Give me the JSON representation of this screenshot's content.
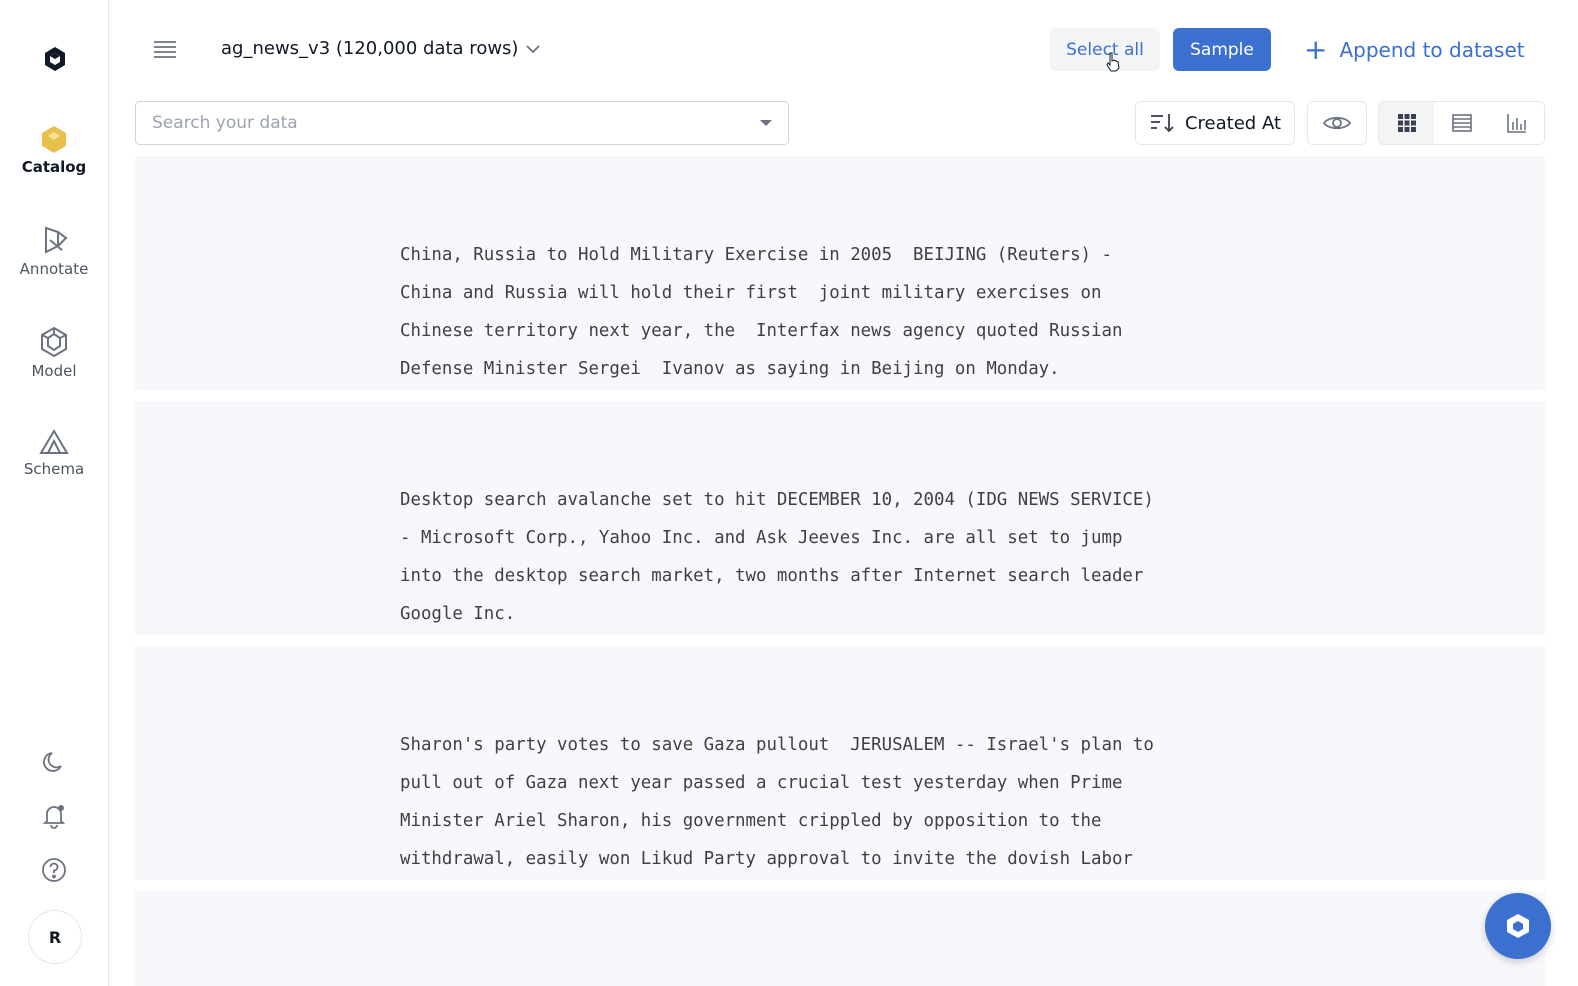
{
  "sidebar": {
    "items": [
      {
        "label": "Catalog",
        "icon": "catalog-icon",
        "active": true
      },
      {
        "label": "Annotate",
        "icon": "annotate-icon",
        "active": false
      },
      {
        "label": "Model",
        "icon": "model-icon",
        "active": false
      },
      {
        "label": "Schema",
        "icon": "schema-icon",
        "active": false
      }
    ],
    "avatar_initial": "R"
  },
  "header": {
    "dataset_title": "ag_news_v3 (120,000 data rows)",
    "select_all_label": "Select all",
    "sample_label": "Sample",
    "append_label": "Append to dataset"
  },
  "toolbar": {
    "search_placeholder": "Search your data",
    "sort_label": "Created At"
  },
  "rows": [
    {
      "text": "China, Russia to Hold Military Exercise in 2005  BEIJING (Reuters) -\nChina and Russia will hold their first  joint military exercises on\nChinese territory next year, the  Interfax news agency quoted Russian\nDefense Minister Sergei  Ivanov as saying in Beijing on Monday."
    },
    {
      "text": "Desktop search avalanche set to hit DECEMBER 10, 2004 (IDG NEWS SERVICE)\n- Microsoft Corp., Yahoo Inc. and Ask Jeeves Inc. are all set to jump\ninto the desktop search market, two months after Internet search leader\nGoogle Inc."
    },
    {
      "text": "Sharon's party votes to save Gaza pullout  JERUSALEM -- Israel's plan to\npull out of Gaza next year passed a crucial test yesterday when Prime\nMinister Ariel Sharon, his government crippled by opposition to the\nwithdrawal, easily won Likud Party approval to invite the dovish Labor"
    },
    {
      "text": ""
    }
  ],
  "colors": {
    "accent": "#3b6fd0",
    "catalog_icon": "#e8c14a",
    "card_bg": "#f7f8fb"
  }
}
